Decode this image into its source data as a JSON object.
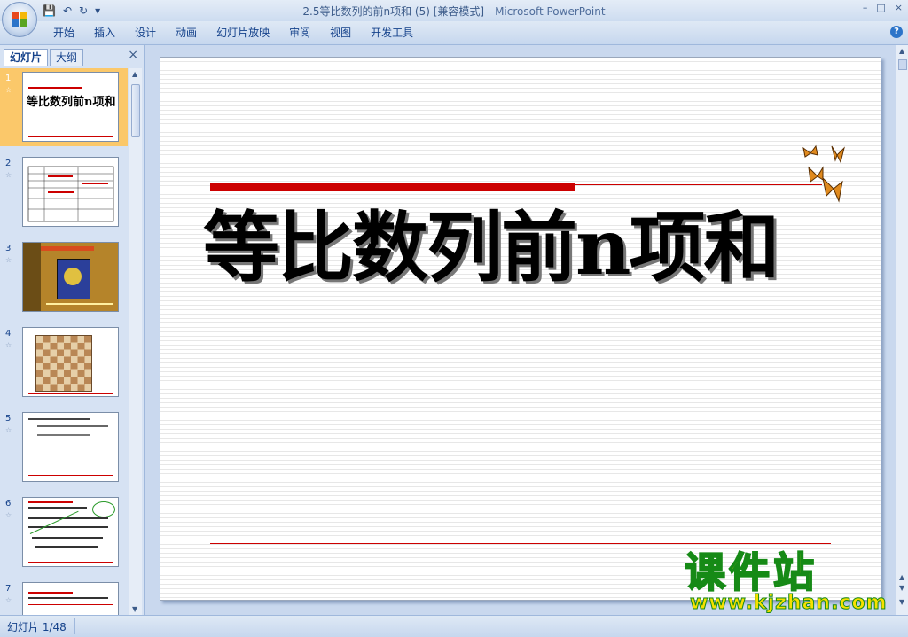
{
  "window": {
    "title": "2.5等比数列的前n项和 (5) [兼容模式]",
    "title_sep": " - ",
    "app_name": "Microsoft PowerPoint",
    "controls": [
      "–",
      "□",
      "×"
    ]
  },
  "quick_access": {
    "save_icon": "💾",
    "undo_icon": "↶",
    "redo_icon": "↻",
    "customize_icon": "▾"
  },
  "menu": {
    "items": [
      "开始",
      "插入",
      "设计",
      "动画",
      "幻灯片放映",
      "审阅",
      "视图",
      "开发工具"
    ],
    "help": "?"
  },
  "left_panel": {
    "tab_slides": "幻灯片",
    "tab_outline": "大纲",
    "close": "×",
    "thumbnails": [
      {
        "num": "1",
        "title": "等比数列前n项和"
      },
      {
        "num": "2"
      },
      {
        "num": "3"
      },
      {
        "num": "4"
      },
      {
        "num": "5"
      },
      {
        "num": "6"
      },
      {
        "num": "7"
      }
    ],
    "star": "☆"
  },
  "slide": {
    "title": "等比数列前n项和"
  },
  "watermark": {
    "main": "课件站",
    "url": "www.kjzhan.com"
  },
  "status": {
    "slide_info": "幻灯片 1/48"
  },
  "colors": {
    "accent_red": "#cc0000",
    "ribbon_blue": "#15428b",
    "selection_orange": "#fbc86a",
    "watermark_yellow": "#f7e000",
    "watermark_green": "#168a16"
  }
}
